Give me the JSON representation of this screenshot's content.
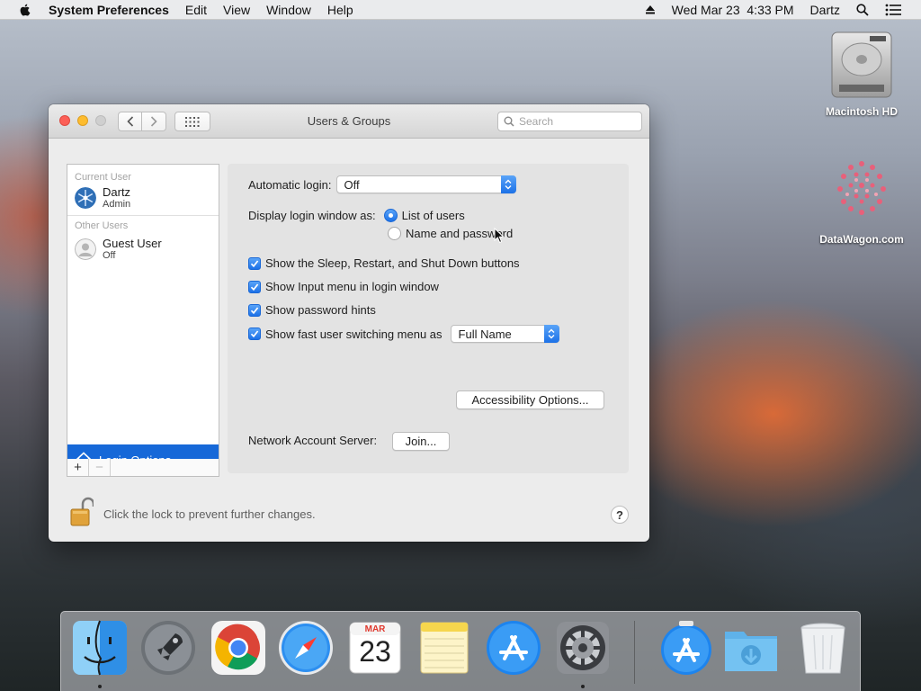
{
  "menubar": {
    "app_name": "System Preferences",
    "menus": [
      "Edit",
      "View",
      "Window",
      "Help"
    ],
    "clock": "Wed Mar 23  4:33 PM",
    "user": "Dartz"
  },
  "desktop": {
    "icons": [
      {
        "label": "Macintosh HD",
        "icon": "hard-drive-icon"
      },
      {
        "label": "DataWagon.com",
        "icon": "datawagon-logo-icon"
      }
    ]
  },
  "window": {
    "title": "Users & Groups",
    "search_placeholder": "Search"
  },
  "users": {
    "current_header": "Current User",
    "current": {
      "name": "Dartz",
      "role": "Admin"
    },
    "other_header": "Other Users",
    "others": [
      {
        "name": "Guest User",
        "status": "Off"
      }
    ],
    "login_options_label": "Login Options",
    "add_label": "+",
    "remove_label": "−"
  },
  "settings": {
    "auto_login_label": "Automatic login:",
    "auto_login_value": "Off",
    "display_as_label": "Display login window as:",
    "radio_list": "List of users",
    "radio_name": "Name and password",
    "radio_selected": "List of users",
    "checkboxes": [
      {
        "label": "Show the Sleep, Restart, and Shut Down buttons",
        "checked": true
      },
      {
        "label": "Show Input menu in login window",
        "checked": true
      },
      {
        "label": "Show password hints",
        "checked": true
      },
      {
        "label": "Show fast user switching menu as",
        "checked": true
      }
    ],
    "fast_switch_value": "Full Name",
    "accessibility_button": "Accessibility Options...",
    "network_label": "Network Account Server:",
    "join_button": "Join..."
  },
  "footer": {
    "lock_text": "Click the lock to prevent further changes.",
    "help_label": "?"
  },
  "dock": {
    "calendar_month": "MAR",
    "calendar_day": "23",
    "apps": [
      "finder-icon",
      "launchpad-icon",
      "chrome-icon",
      "safari-icon",
      "calendar-icon",
      "notes-icon",
      "app-store-icon",
      "system-preferences-icon",
      "app-store-download-icon",
      "downloads-folder-icon",
      "trash-icon"
    ]
  },
  "colors": {
    "accent": "#1c71e7",
    "selection": "#1668d8",
    "close": "#fc5f57",
    "minimize": "#fdbc2e"
  }
}
